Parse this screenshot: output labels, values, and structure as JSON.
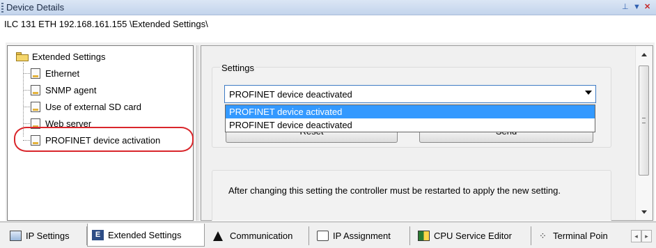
{
  "window": {
    "title": "Device Details",
    "path": "ILC 131 ETH 192.168.161.155 \\Extended Settings\\",
    "controls": {
      "pin": "⊥",
      "dropdown": "▼",
      "close": "✕"
    }
  },
  "tree": {
    "root": {
      "label": "Extended Settings",
      "icon": "folder-icon"
    },
    "items": [
      {
        "label": "Ethernet",
        "icon": "settings-doc-icon"
      },
      {
        "label": "SNMP agent",
        "icon": "settings-doc-icon"
      },
      {
        "label": "Use of external SD card",
        "icon": "settings-doc-icon"
      },
      {
        "label": "Web server",
        "icon": "settings-doc-icon"
      },
      {
        "label": "PROFINET device activation",
        "icon": "settings-doc-icon"
      }
    ],
    "highlight_color": "#d9262b"
  },
  "settings": {
    "group_label": "Settings",
    "select": {
      "value": "PROFINET device deactivated",
      "options": [
        "PROFINET device activated",
        "PROFINET device deactivated"
      ],
      "highlighted_option": "PROFINET device activated"
    },
    "buttons": {
      "reset": "Reset",
      "send": "Send"
    }
  },
  "info": {
    "text": "After changing this setting the controller must be restarted to apply the new setting."
  },
  "tabs": [
    {
      "label": "IP Settings",
      "icon": "ip-settings-icon",
      "active": false
    },
    {
      "label": "Extended Settings",
      "icon": "extended-settings-icon",
      "active": true
    },
    {
      "label": "Communication",
      "icon": "communication-icon",
      "active": false
    },
    {
      "label": "IP Assignment",
      "icon": "ip-assignment-icon",
      "active": false
    },
    {
      "label": "CPU Service Editor",
      "icon": "cpu-service-editor-icon",
      "active": false
    },
    {
      "label": "Terminal Poin",
      "icon": "terminal-points-icon",
      "active": false
    }
  ],
  "colors": {
    "selection": "#3399ff",
    "select_border": "#3d7bc4",
    "titlebar": "#c3d4ec"
  }
}
